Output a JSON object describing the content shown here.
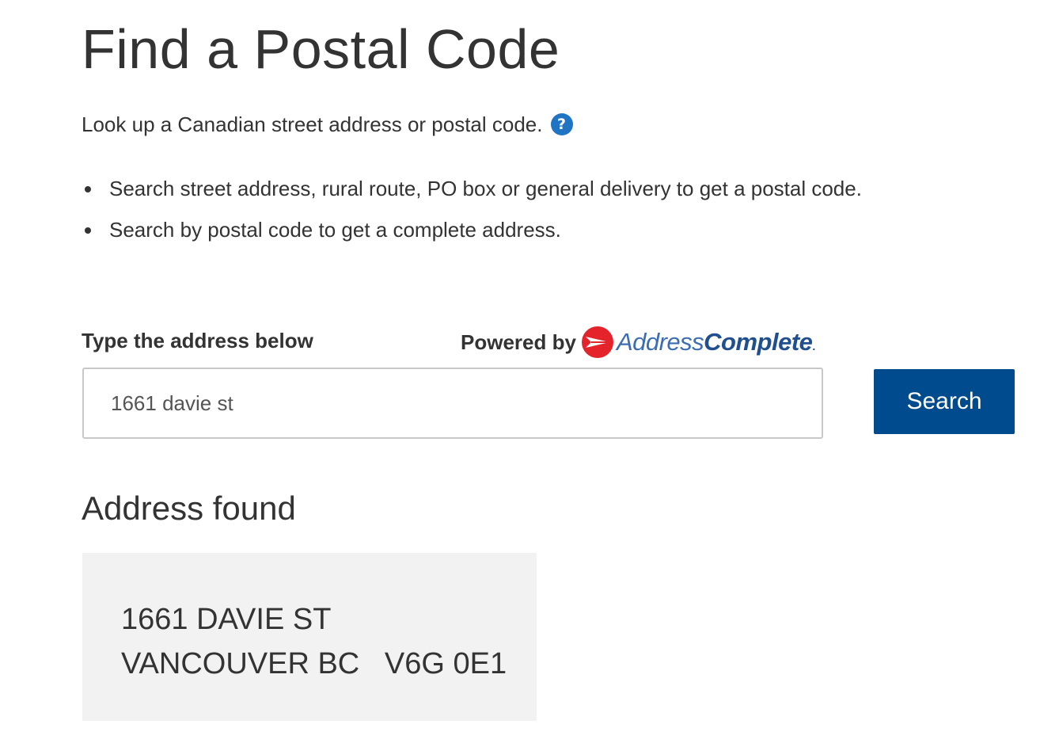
{
  "page": {
    "title": "Find a Postal Code",
    "intro": "Look up a Canadian street address or postal code.",
    "help_icon": "question-circle-icon",
    "tips": [
      "Search street address, rural route, PO box or general delivery to get a postal code.",
      "Search by postal code to get a complete address."
    ]
  },
  "search": {
    "label": "Type the address below",
    "powered_by": "Powered by",
    "brand_light": "Address",
    "brand_bold": "Complete",
    "brand_dot": ".",
    "input_value": "1661 davie st",
    "button_label": "Search",
    "button_color": "#004b8d"
  },
  "results": {
    "title": "Address found",
    "address_line1": "1661 DAVIE ST",
    "address_line2": "VANCOUVER BC   V6G 0E1"
  }
}
